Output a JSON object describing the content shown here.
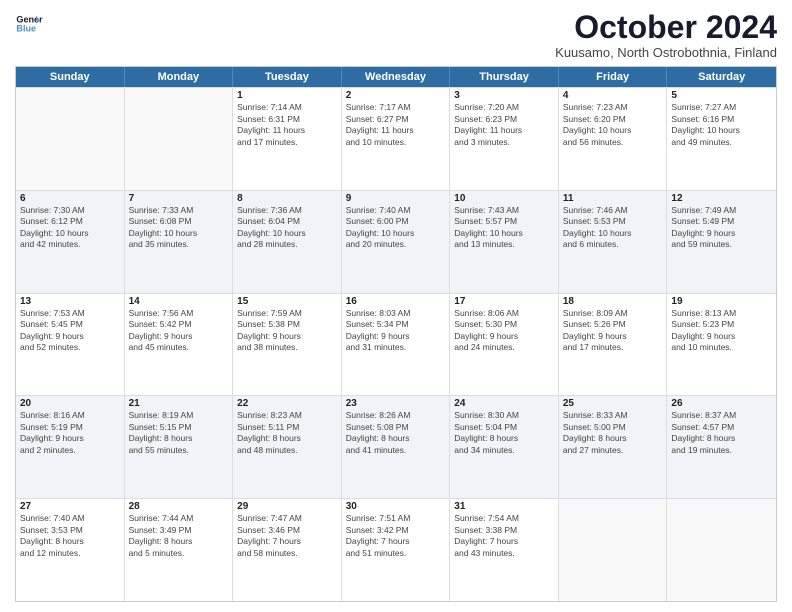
{
  "logo": {
    "line1": "General",
    "line2": "Blue"
  },
  "title": "October 2024",
  "subtitle": "Kuusamo, North Ostrobothnia, Finland",
  "header_days": [
    "Sunday",
    "Monday",
    "Tuesday",
    "Wednesday",
    "Thursday",
    "Friday",
    "Saturday"
  ],
  "weeks": [
    [
      {
        "day": "",
        "text": ""
      },
      {
        "day": "",
        "text": ""
      },
      {
        "day": "1",
        "text": "Sunrise: 7:14 AM\nSunset: 6:31 PM\nDaylight: 11 hours\nand 17 minutes."
      },
      {
        "day": "2",
        "text": "Sunrise: 7:17 AM\nSunset: 6:27 PM\nDaylight: 11 hours\nand 10 minutes."
      },
      {
        "day": "3",
        "text": "Sunrise: 7:20 AM\nSunset: 6:23 PM\nDaylight: 11 hours\nand 3 minutes."
      },
      {
        "day": "4",
        "text": "Sunrise: 7:23 AM\nSunset: 6:20 PM\nDaylight: 10 hours\nand 56 minutes."
      },
      {
        "day": "5",
        "text": "Sunrise: 7:27 AM\nSunset: 6:16 PM\nDaylight: 10 hours\nand 49 minutes."
      }
    ],
    [
      {
        "day": "6",
        "text": "Sunrise: 7:30 AM\nSunset: 6:12 PM\nDaylight: 10 hours\nand 42 minutes."
      },
      {
        "day": "7",
        "text": "Sunrise: 7:33 AM\nSunset: 6:08 PM\nDaylight: 10 hours\nand 35 minutes."
      },
      {
        "day": "8",
        "text": "Sunrise: 7:36 AM\nSunset: 6:04 PM\nDaylight: 10 hours\nand 28 minutes."
      },
      {
        "day": "9",
        "text": "Sunrise: 7:40 AM\nSunset: 6:00 PM\nDaylight: 10 hours\nand 20 minutes."
      },
      {
        "day": "10",
        "text": "Sunrise: 7:43 AM\nSunset: 5:57 PM\nDaylight: 10 hours\nand 13 minutes."
      },
      {
        "day": "11",
        "text": "Sunrise: 7:46 AM\nSunset: 5:53 PM\nDaylight: 10 hours\nand 6 minutes."
      },
      {
        "day": "12",
        "text": "Sunrise: 7:49 AM\nSunset: 5:49 PM\nDaylight: 9 hours\nand 59 minutes."
      }
    ],
    [
      {
        "day": "13",
        "text": "Sunrise: 7:53 AM\nSunset: 5:45 PM\nDaylight: 9 hours\nand 52 minutes."
      },
      {
        "day": "14",
        "text": "Sunrise: 7:56 AM\nSunset: 5:42 PM\nDaylight: 9 hours\nand 45 minutes."
      },
      {
        "day": "15",
        "text": "Sunrise: 7:59 AM\nSunset: 5:38 PM\nDaylight: 9 hours\nand 38 minutes."
      },
      {
        "day": "16",
        "text": "Sunrise: 8:03 AM\nSunset: 5:34 PM\nDaylight: 9 hours\nand 31 minutes."
      },
      {
        "day": "17",
        "text": "Sunrise: 8:06 AM\nSunset: 5:30 PM\nDaylight: 9 hours\nand 24 minutes."
      },
      {
        "day": "18",
        "text": "Sunrise: 8:09 AM\nSunset: 5:26 PM\nDaylight: 9 hours\nand 17 minutes."
      },
      {
        "day": "19",
        "text": "Sunrise: 8:13 AM\nSunset: 5:23 PM\nDaylight: 9 hours\nand 10 minutes."
      }
    ],
    [
      {
        "day": "20",
        "text": "Sunrise: 8:16 AM\nSunset: 5:19 PM\nDaylight: 9 hours\nand 2 minutes."
      },
      {
        "day": "21",
        "text": "Sunrise: 8:19 AM\nSunset: 5:15 PM\nDaylight: 8 hours\nand 55 minutes."
      },
      {
        "day": "22",
        "text": "Sunrise: 8:23 AM\nSunset: 5:11 PM\nDaylight: 8 hours\nand 48 minutes."
      },
      {
        "day": "23",
        "text": "Sunrise: 8:26 AM\nSunset: 5:08 PM\nDaylight: 8 hours\nand 41 minutes."
      },
      {
        "day": "24",
        "text": "Sunrise: 8:30 AM\nSunset: 5:04 PM\nDaylight: 8 hours\nand 34 minutes."
      },
      {
        "day": "25",
        "text": "Sunrise: 8:33 AM\nSunset: 5:00 PM\nDaylight: 8 hours\nand 27 minutes."
      },
      {
        "day": "26",
        "text": "Sunrise: 8:37 AM\nSunset: 4:57 PM\nDaylight: 8 hours\nand 19 minutes."
      }
    ],
    [
      {
        "day": "27",
        "text": "Sunrise: 7:40 AM\nSunset: 3:53 PM\nDaylight: 8 hours\nand 12 minutes."
      },
      {
        "day": "28",
        "text": "Sunrise: 7:44 AM\nSunset: 3:49 PM\nDaylight: 8 hours\nand 5 minutes."
      },
      {
        "day": "29",
        "text": "Sunrise: 7:47 AM\nSunset: 3:46 PM\nDaylight: 7 hours\nand 58 minutes."
      },
      {
        "day": "30",
        "text": "Sunrise: 7:51 AM\nSunset: 3:42 PM\nDaylight: 7 hours\nand 51 minutes."
      },
      {
        "day": "31",
        "text": "Sunrise: 7:54 AM\nSunset: 3:38 PM\nDaylight: 7 hours\nand 43 minutes."
      },
      {
        "day": "",
        "text": ""
      },
      {
        "day": "",
        "text": ""
      }
    ]
  ]
}
